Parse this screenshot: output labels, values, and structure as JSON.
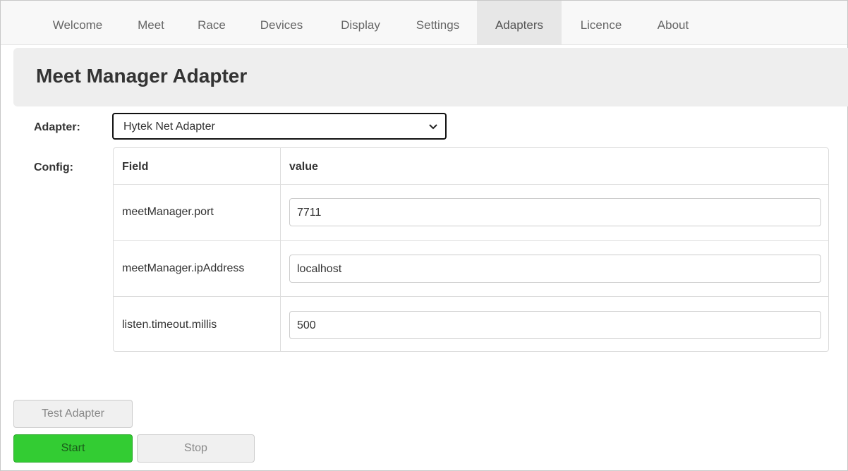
{
  "nav": {
    "items": [
      {
        "label": "Welcome",
        "active": false
      },
      {
        "label": "Meet",
        "active": false
      },
      {
        "label": "Race",
        "active": false
      },
      {
        "label": "Devices",
        "active": false
      },
      {
        "label": "Display",
        "active": false
      },
      {
        "label": "Settings",
        "active": false
      },
      {
        "label": "Adapters",
        "active": true
      },
      {
        "label": "Licence",
        "active": false
      },
      {
        "label": "About",
        "active": false
      }
    ]
  },
  "page": {
    "title": "Meet Manager Adapter"
  },
  "adapter": {
    "label": "Adapter:",
    "selected": "Hytek Net Adapter",
    "icon": "chevron-down-icon"
  },
  "config": {
    "label": "Config:",
    "headers": {
      "field": "Field",
      "value": "value"
    },
    "rows": [
      {
        "field": "meetManager.port",
        "value": "7711"
      },
      {
        "field": "meetManager.ipAddress",
        "value": "localhost"
      },
      {
        "field": "listen.timeout.millis",
        "value": "500"
      }
    ]
  },
  "buttons": {
    "test": "Test Adapter",
    "start": "Start",
    "stop": "Stop"
  },
  "colors": {
    "start_button": "#33cc33",
    "header_bg": "#eeeeee",
    "nav_active_bg": "#e7e7e7"
  }
}
